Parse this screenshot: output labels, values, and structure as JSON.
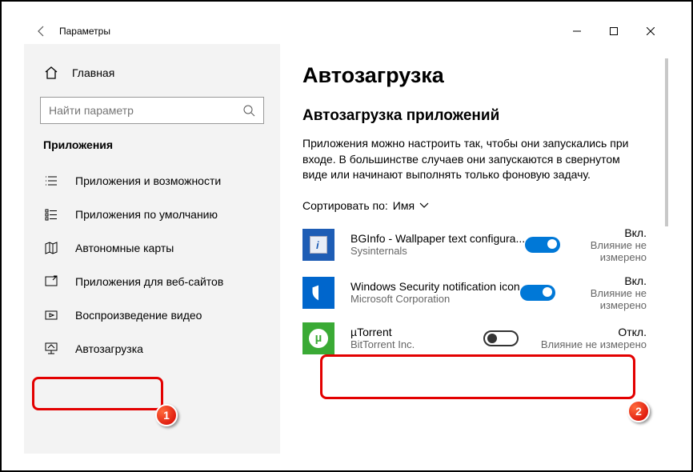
{
  "window": {
    "title": "Параметры"
  },
  "sidebar": {
    "home": "Главная",
    "search_placeholder": "Найти параметр",
    "section": "Приложения",
    "items": [
      {
        "label": "Приложения и возможности"
      },
      {
        "label": "Приложения по умолчанию"
      },
      {
        "label": "Автономные карты"
      },
      {
        "label": "Приложения для веб-сайтов"
      },
      {
        "label": "Воспроизведение видео"
      },
      {
        "label": "Автозагрузка"
      }
    ]
  },
  "main": {
    "h1": "Автозагрузка",
    "h2": "Автозагрузка приложений",
    "desc": "Приложения можно настроить так, чтобы они запускались при входе. В большинстве случаев они запускаются в свернутом виде или начинают выполнять только фоновую задачу.",
    "sort_label": "Сортировать по:",
    "sort_value": "Имя",
    "apps": [
      {
        "name": "BGInfo - Wallpaper text configura...",
        "publisher": "Sysinternals",
        "on": true,
        "state": "Вкл.",
        "impact": "Влияние не измерено"
      },
      {
        "name": "Windows Security notification icon",
        "publisher": "Microsoft Corporation",
        "on": true,
        "state": "Вкл.",
        "impact": "Влияние не измерено"
      },
      {
        "name": "µTorrent",
        "publisher": "BitTorrent Inc.",
        "on": false,
        "state": "Откл.",
        "impact": "Влияние не измерено"
      }
    ]
  },
  "annotations": {
    "badge1": "1",
    "badge2": "2"
  }
}
